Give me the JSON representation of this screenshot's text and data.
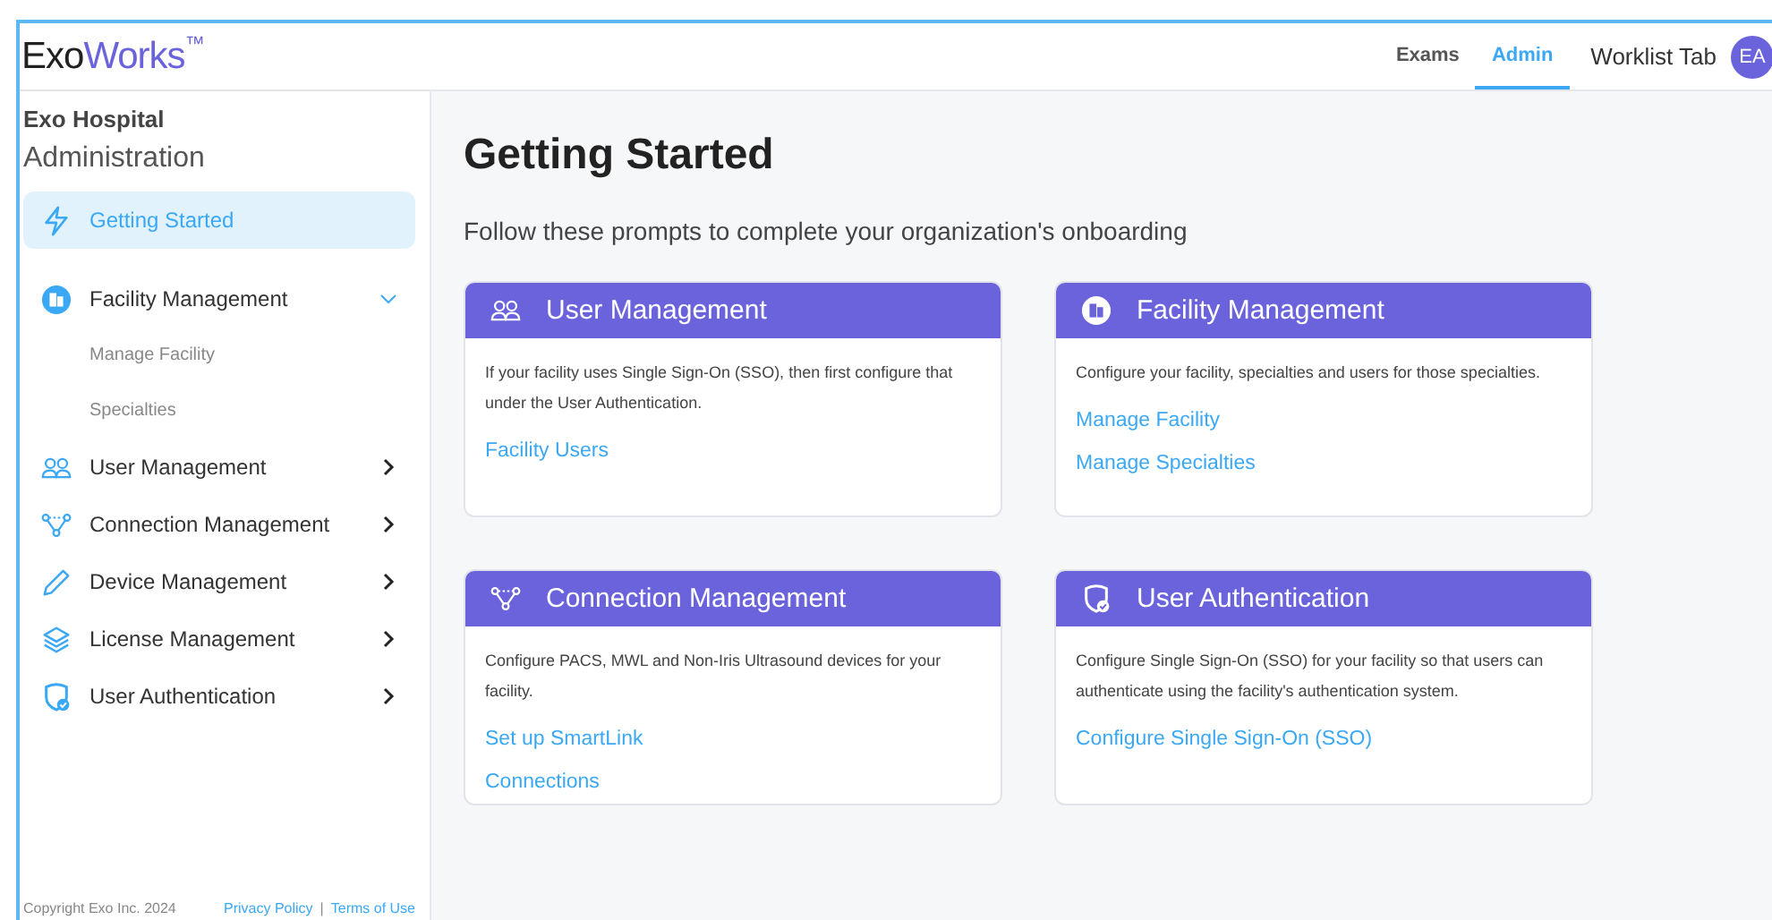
{
  "header": {
    "logo": {
      "part_1": "Exo",
      "part_2": "Works",
      "mark": "™"
    },
    "tabs": [
      {
        "label": "Exams",
        "selected": false,
        "kind": "tab"
      },
      {
        "label": "Admin",
        "selected": true,
        "kind": "tab"
      },
      {
        "label": "Worklist Tab",
        "selected": false,
        "kind": "plain"
      }
    ],
    "avatar": "EA"
  },
  "sidebar": {
    "organization": "Exo Hospital",
    "section": "Administration",
    "items": [
      {
        "label": "Getting Started",
        "kind": "bolt",
        "selected": true
      },
      {
        "label": "Facility Management",
        "kind": "building",
        "selected": false,
        "expanded": true,
        "children": [
          {
            "label": "Manage Facility"
          },
          {
            "label": "Specialties"
          }
        ]
      },
      {
        "label": "User Management",
        "kind": "users",
        "selected": false,
        "expanded": false
      },
      {
        "label": "Connection Management",
        "kind": "network",
        "selected": false,
        "expanded": false
      },
      {
        "label": "Device Management",
        "kind": "pencil",
        "selected": false,
        "expanded": false
      },
      {
        "label": "License Management",
        "kind": "layers",
        "selected": false,
        "expanded": false
      },
      {
        "label": "User Authentication",
        "kind": "shield",
        "selected": false,
        "expanded": false
      }
    ],
    "footer": {
      "copyright": "Copyright Exo Inc. 2024",
      "links": [
        "Privacy Policy",
        "Terms of Use"
      ],
      "separator": "|"
    }
  },
  "main": {
    "title": "Getting Started",
    "subtitle": "Follow these prompts to complete your organization's onboarding",
    "cards": [
      {
        "title": "User Management",
        "kind": "users",
        "description": "If your facility uses Single Sign-On (SSO), then first configure that under the User Authentication.",
        "links": [
          "Facility Users"
        ]
      },
      {
        "title": "Facility Management",
        "kind": "building",
        "description": "Configure your facility, specialties and users for those specialties.",
        "links": [
          "Manage Facility",
          "Manage Specialties"
        ]
      },
      {
        "title": "Connection Management",
        "kind": "network",
        "description": "Configure PACS, MWL and Non-Iris Ultrasound devices for your facility.",
        "links": [
          "Set up SmartLink",
          "Connections"
        ]
      },
      {
        "title": "User Authentication",
        "kind": "shield",
        "description": "Configure Single Sign-On (SSO) for your facility so that users can authenticate using the facility's authentication system.",
        "links": [
          "Configure Single Sign-On (SSO)"
        ]
      }
    ]
  }
}
